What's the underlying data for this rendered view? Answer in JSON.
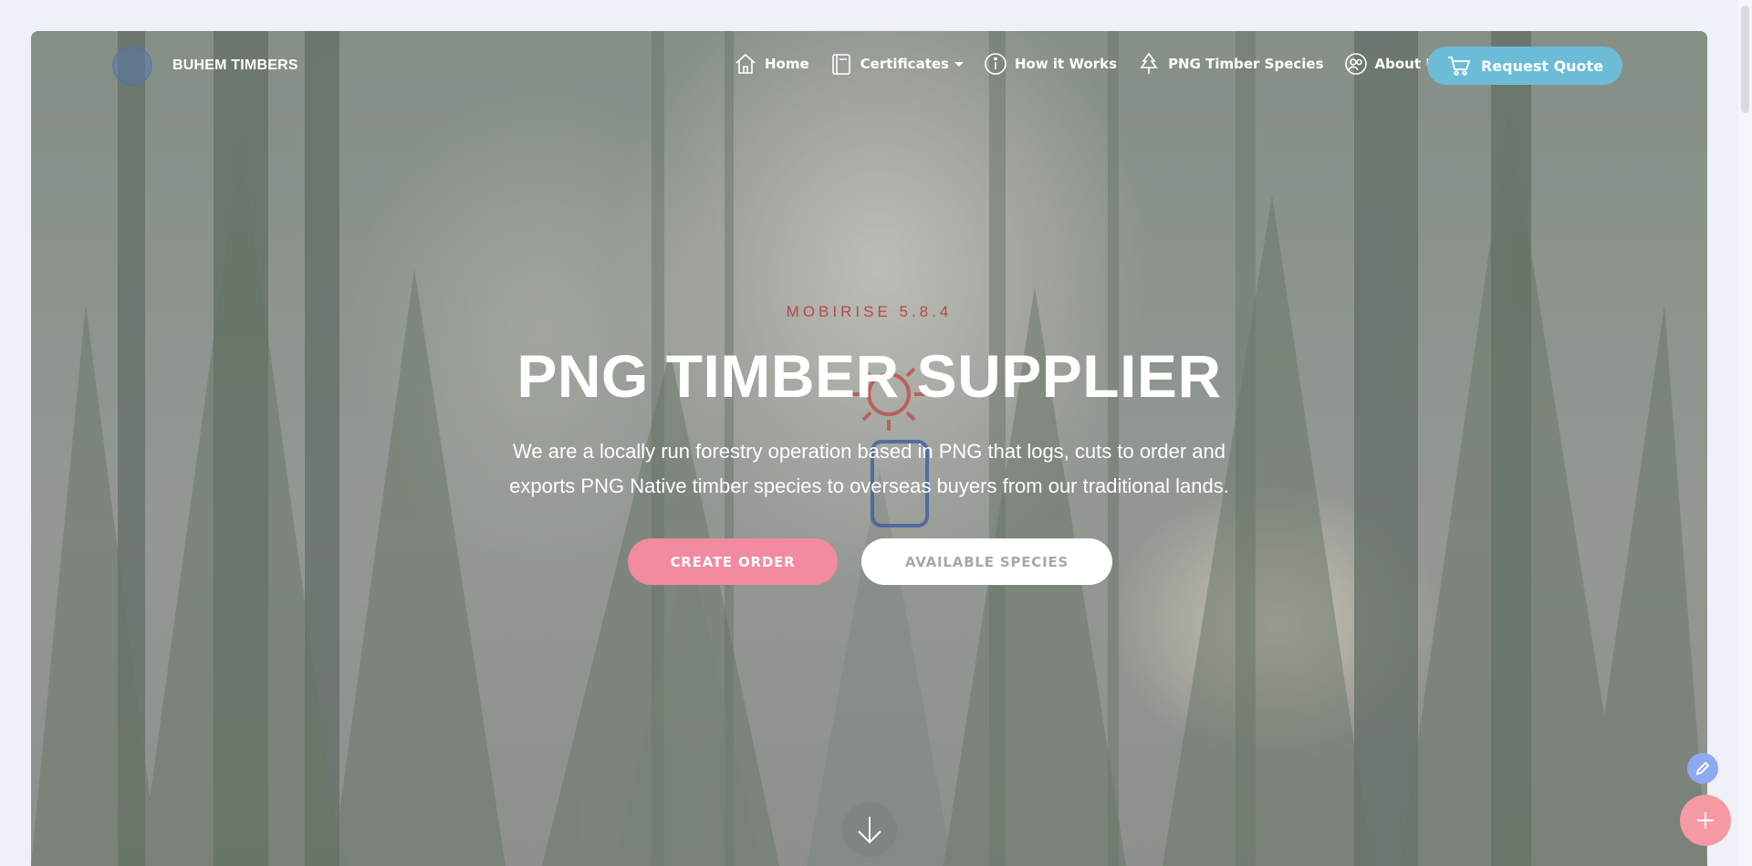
{
  "brand": {
    "name": "BUHEM TIMBERS",
    "logo_icon": "brand-logo-circle"
  },
  "nav": {
    "items": [
      {
        "label": "Home",
        "icon": "home-icon"
      },
      {
        "label": "Certificates",
        "icon": "certificate-icon",
        "has_dropdown": true
      },
      {
        "label": "How it Works",
        "icon": "info-icon"
      },
      {
        "label": "PNG Timber Species",
        "icon": "tree-icon"
      },
      {
        "label": "About Us",
        "icon": "people-icon"
      }
    ],
    "cta": {
      "label": "Request Quote",
      "icon": "cart-icon",
      "color": "#6cbcd8"
    }
  },
  "hero": {
    "kicker": "MOBIRISE  5.8.4",
    "title": "PNG TIMBER SUPPLIER",
    "description_line1": "We are a locally run forestry operation based in PNG that logs, cuts to order and",
    "description_line2": "exports PNG Native timber species to overseas buyers from our traditional lands.",
    "primary_button": {
      "label": "CREATE ORDER",
      "color": "#f28aa0"
    },
    "secondary_button": {
      "label": "AVAILABLE SPECIES",
      "color": "#ffffff"
    },
    "scroll_down_icon": "arrow-down-icon"
  },
  "floating": {
    "edit_icon": "pencil-icon",
    "add_icon": "plus-icon",
    "edit_color": "#8ea9f0",
    "add_color": "#f59aa4"
  }
}
